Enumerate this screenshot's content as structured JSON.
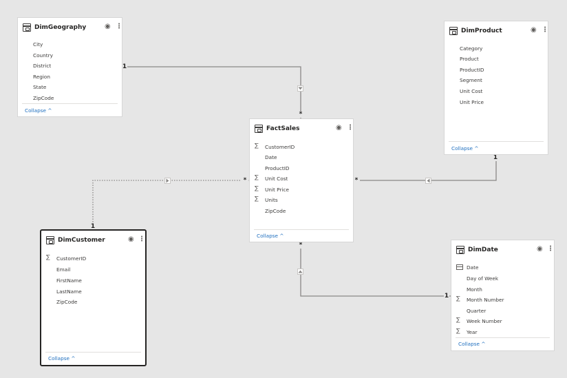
{
  "tables": {
    "geography": {
      "title": "DimGeography",
      "fields": [
        "City",
        "Country",
        "District",
        "Region",
        "State",
        "ZipCode"
      ],
      "collapse": "Collapse"
    },
    "product": {
      "title": "DimProduct",
      "fields": [
        "Category",
        "Product",
        "ProductID",
        "Segment",
        "Unit Cost",
        "Unit Price"
      ],
      "collapse": "Collapse"
    },
    "factsales": {
      "title": "FactSales",
      "fields": [
        "CustomerID",
        "Date",
        "ProductID",
        "Unit Cost",
        "Unit Price",
        "Units",
        "ZipCode"
      ],
      "collapse": "Collapse"
    },
    "customer": {
      "title": "DimCustomer",
      "fields": [
        "CustomerID",
        "Email",
        "FirstName",
        "LastName",
        "ZipCode"
      ],
      "collapse": "Collapse"
    },
    "date": {
      "title": "DimDate",
      "fields": [
        "Date",
        "Day of Week",
        "Month",
        "Month Number",
        "Quarter",
        "Week Number",
        "Year"
      ],
      "collapse": "Collapse"
    }
  },
  "relationships": {
    "one": "1",
    "many": "*"
  },
  "icons": {
    "visibility": "eye-icon",
    "more": "more-options-icon",
    "table": "table-icon",
    "sum": "sigma-icon",
    "calendar": "calendar-icon"
  },
  "colors": {
    "canvas": "#e6e6e6",
    "link": "#1f6fbf",
    "line": "#8a8886"
  }
}
